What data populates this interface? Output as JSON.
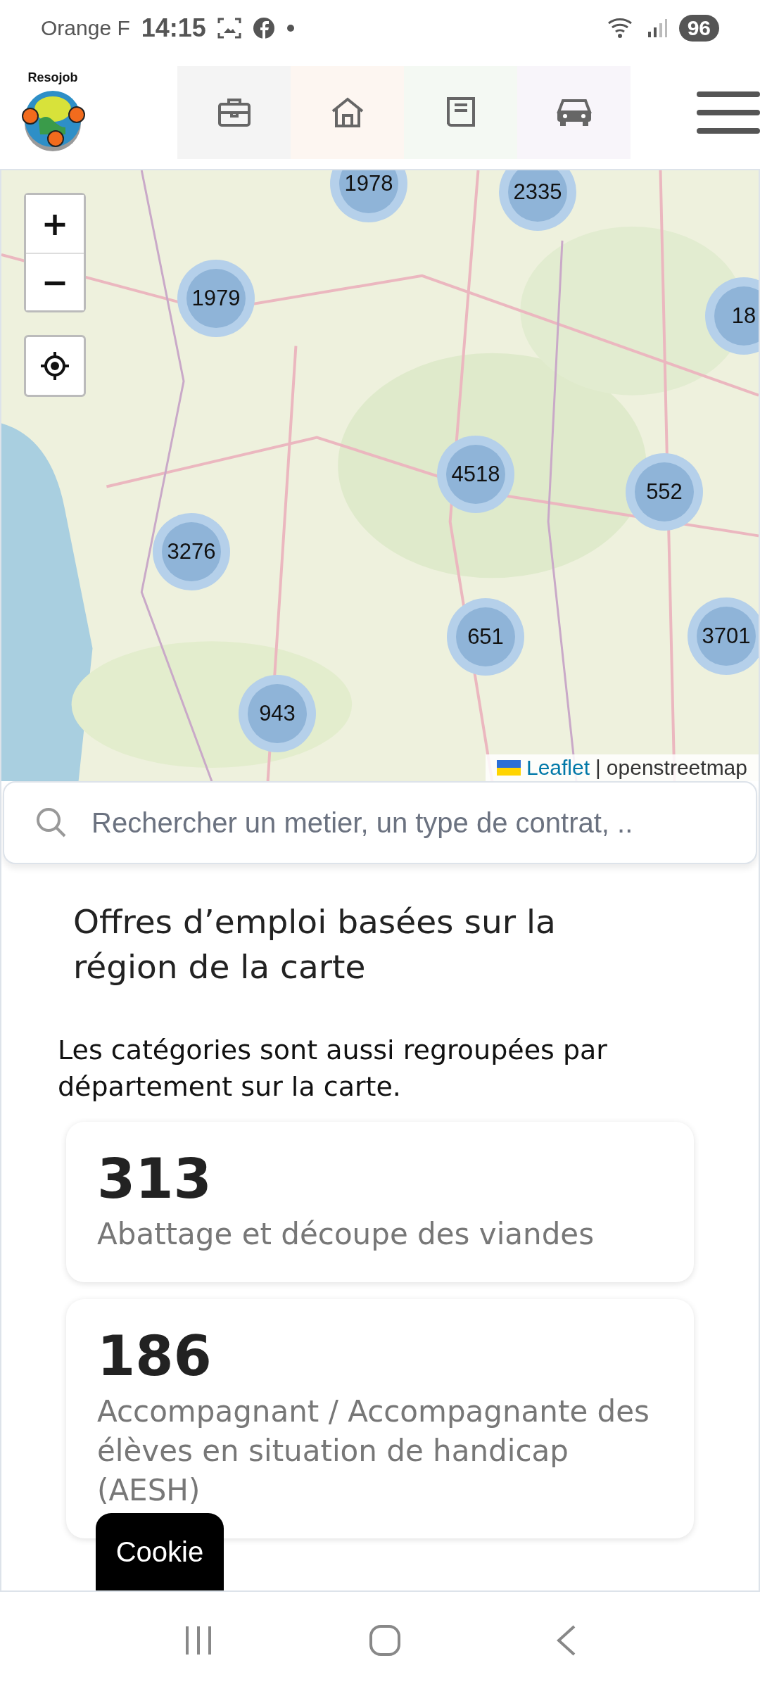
{
  "status_bar": {
    "carrier": "Orange F",
    "time": "14:15",
    "battery": "96"
  },
  "header": {
    "logo_text": "Resojob",
    "nav_tabs": [
      {
        "kind": "briefcase",
        "color": "#f4f4f4"
      },
      {
        "kind": "house",
        "color": "#fdf6f1"
      },
      {
        "kind": "book",
        "color": "#f4f9f3"
      },
      {
        "kind": "car",
        "color": "#f8f5fa"
      }
    ]
  },
  "map": {
    "zoom_in": "+",
    "zoom_out": "−",
    "clusters": [
      {
        "count": "1978"
      },
      {
        "count": "2335"
      },
      {
        "count": "1979"
      },
      {
        "count": "18"
      },
      {
        "count": "4518"
      },
      {
        "count": "552"
      },
      {
        "count": "3276"
      },
      {
        "count": "651"
      },
      {
        "count": "3701"
      },
      {
        "count": "943"
      }
    ],
    "attribution": {
      "link": "Leaflet",
      "separator": "|",
      "text": "openstreetmap"
    }
  },
  "search": {
    "placeholder": "Rechercher un metier, un type de contrat, .."
  },
  "heading": "Offres d’emploi basées sur la région de la carte",
  "intro": "Les catégories sont aussi regroupées par département sur la carte.",
  "categories": [
    {
      "count": "313",
      "label": "Abattage et découpe des viandes"
    },
    {
      "count": "186",
      "label": "Accompagnant / Accompagnante des élèves en situation de handicap (AESH)"
    }
  ],
  "cookie_button": "Cookie"
}
